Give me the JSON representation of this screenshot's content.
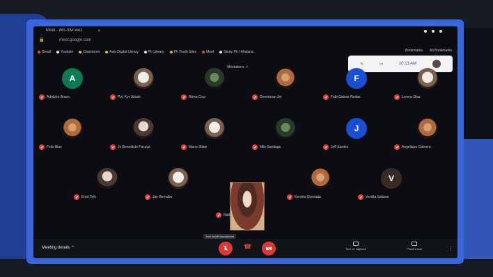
{
  "browser": {
    "tab_title": "Meet - dds-fiwr-wez",
    "address": "meet.google.com",
    "bookmarks": [
      {
        "label": "Gmail",
        "color": "red"
      },
      {
        "label": "Youtube",
        "color": "white"
      },
      {
        "label": "Classroom",
        "color": "yellow"
      },
      {
        "label": "Asia Digital Library",
        "color": "yellow"
      },
      {
        "label": "Ph Library",
        "color": "white"
      },
      {
        "label": "Ph Youth Sites",
        "color": "yellow"
      },
      {
        "label": "Meet",
        "color": "red"
      },
      {
        "label": "Study Ph / Ahalana",
        "color": "white"
      }
    ],
    "right_bookmarks": [
      "Bookmarks",
      "All Bookmarks"
    ]
  },
  "meeting": {
    "presenting_label": "Meetations ↗",
    "top_time": "10:13 AM",
    "details_label": "Meeting details",
    "hover_tip": "Turn on/off microphone",
    "controls": {
      "captions": "Turn on captions",
      "present": "Present now"
    }
  },
  "participants": [
    {
      "name": "Adolpho Bravo",
      "avatar": "A",
      "color": "#0d7a52"
    },
    {
      "name": "Pvt. Kyr Sibale",
      "avatar": "",
      "style": "photo2"
    },
    {
      "name": "Alexa Cruz",
      "avatar": "",
      "style": "photo3"
    },
    {
      "name": "Dominican Jer",
      "avatar": "",
      "style": "photo4"
    },
    {
      "name": "Fabi Galvez Rodas",
      "avatar": "F",
      "color": "#1a4fd1"
    },
    {
      "name": "Lorenz Diaz",
      "avatar": "",
      "style": "photo2"
    },
    {
      "name": "Felix Blas",
      "avatar": "",
      "style": "photo4"
    },
    {
      "name": "Jo Benedicto Facuya",
      "avatar": "",
      "style": "photo"
    },
    {
      "name": "Marco Blasi",
      "avatar": "",
      "style": "photo2"
    },
    {
      "name": "Milo Santiago",
      "avatar": "",
      "style": "photo3"
    },
    {
      "name": "Jeff Sardez",
      "avatar": "J",
      "color": "#1a4fd1"
    },
    {
      "name": "Angelique Cabrera",
      "avatar": "",
      "style": "photo4"
    },
    {
      "name": "Errol Tolo",
      "avatar": "",
      "style": "photo"
    },
    {
      "name": "Jan Bernabe",
      "avatar": "",
      "style": "photo2"
    },
    {
      "name": "Nadine Bulaong",
      "avatar": "",
      "style": "featured"
    },
    {
      "name": "Kendra Quezada",
      "avatar": "",
      "style": "photo4"
    },
    {
      "name": "Venitta Salazar",
      "avatar": "V",
      "color": "#3a2a24"
    }
  ]
}
